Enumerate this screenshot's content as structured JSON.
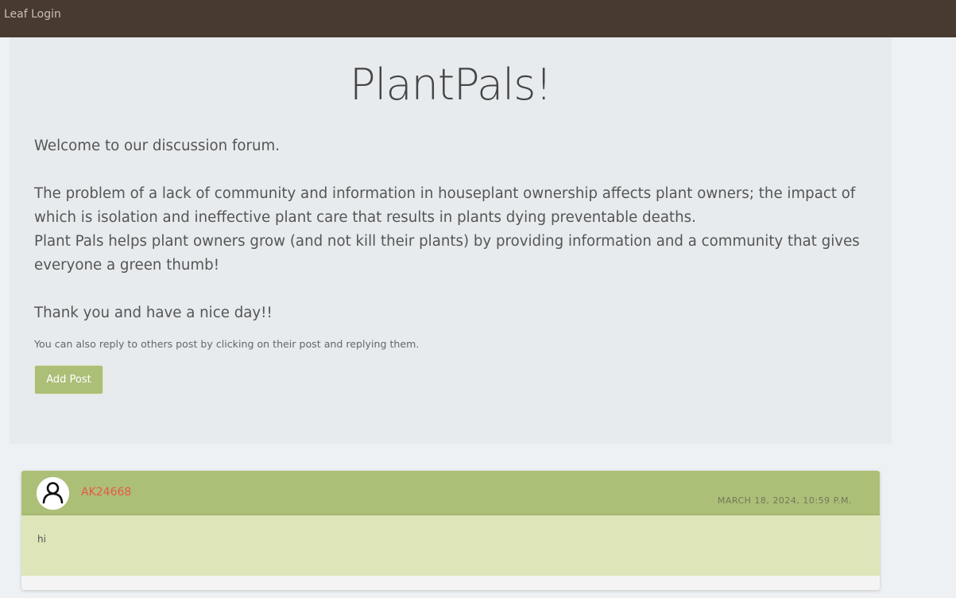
{
  "navbar": {
    "brand": "Leaf Login"
  },
  "hero": {
    "title": "PlantPals!",
    "welcome": "Welcome to our discussion forum.",
    "problem": "The problem of a lack of community and information in houseplant ownership affects plant owners; the impact of which is isolation and ineffective plant care that results in plants dying preventable deaths.",
    "mission": "Plant Pals helps plant owners grow (and not kill their plants) by providing information and a community that gives everyone a green thumb!",
    "thanks": "Thank you and have a nice day!!",
    "hint": "You can also reply to others post by clicking on their post and replying them.",
    "add_post_label": "Add Post"
  },
  "posts": [
    {
      "username": "AK24668",
      "timestamp": "MARCH 18, 2024, 10:59 P.M.",
      "content": "hi",
      "avatar_icon": "user-icon"
    }
  ],
  "colors": {
    "navbar": "#483a30",
    "accent_green": "#acbf77",
    "post_body": "#dee5b8",
    "username": "#e8574a"
  }
}
